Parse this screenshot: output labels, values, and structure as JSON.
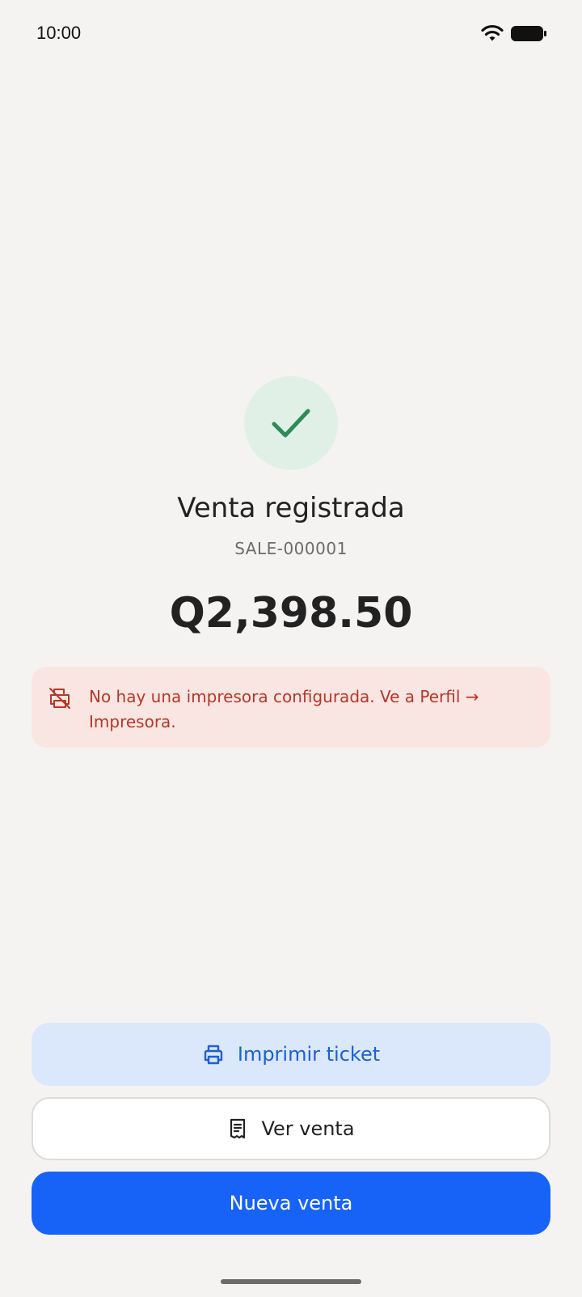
{
  "status_bar": {
    "time": "10:00"
  },
  "result": {
    "title": "Venta registrada",
    "sale_id": "SALE-000001",
    "amount": "Q2,398.50"
  },
  "alert": {
    "message": "No hay una impresora configurada. Ve a Perfil → Impresora.",
    "icon": "printer-off-icon",
    "color": "#b5372a"
  },
  "actions": {
    "print_label": "Imprimir ticket",
    "view_label": "Ver venta",
    "new_label": "Nueva venta"
  },
  "colors": {
    "primary": "#1762f7",
    "success": "#2e8b57",
    "background": "#f5f3f1"
  }
}
